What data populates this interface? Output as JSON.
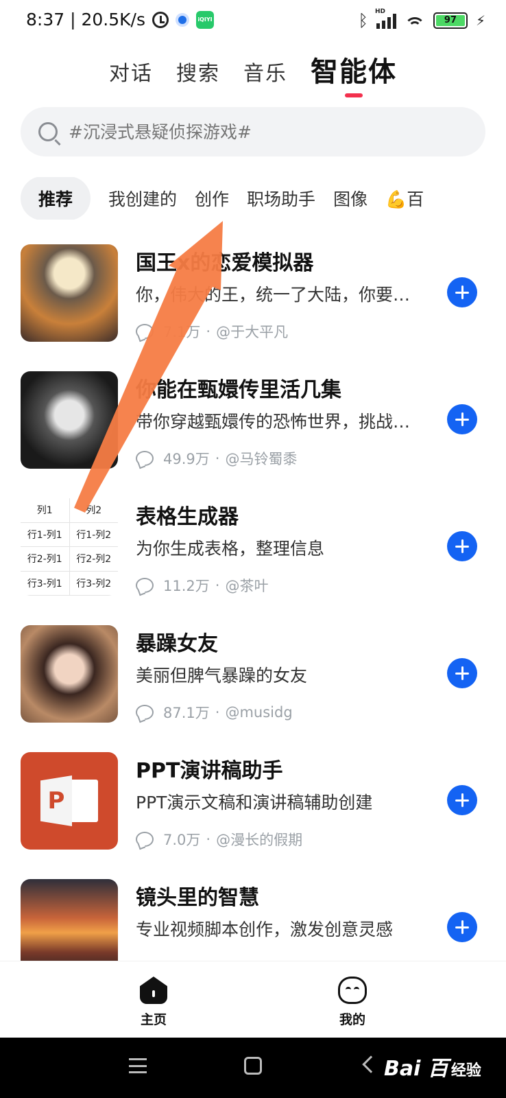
{
  "status_bar": {
    "time_speed": "8:37 | 20.5K/s",
    "battery": "97",
    "hd_label": "HD"
  },
  "top_tabs": [
    {
      "label": "对话"
    },
    {
      "label": "搜索"
    },
    {
      "label": "音乐"
    },
    {
      "label": "智能体"
    }
  ],
  "search": {
    "placeholder": "#沉浸式悬疑侦探游戏#"
  },
  "categories": [
    {
      "label": "推荐"
    },
    {
      "label": "我创建的"
    },
    {
      "label": "创作"
    },
    {
      "label": "职场助手"
    },
    {
      "label": "图像"
    },
    {
      "label": "💪百"
    }
  ],
  "agents": [
    {
      "title": "国王x的恋爱模拟器",
      "desc": "你，伟大的王，统一了大陆，你要…",
      "count": "7.1万",
      "author": "@于大平凡"
    },
    {
      "title": "你能在甄嬛传里活几集",
      "desc": "带你穿越甄嬛传的恐怖世界，挑战…",
      "count": "49.9万",
      "author": "@马铃蜀黍"
    },
    {
      "title": "表格生成器",
      "desc": "为你生成表格，整理信息",
      "count": "11.2万",
      "author": "@茶叶"
    },
    {
      "title": "暴躁女友",
      "desc": "美丽但脾气暴躁的女友",
      "count": "87.1万",
      "author": "@musidg"
    },
    {
      "title": "PPT演讲稿助手",
      "desc": "PPT演示文稿和演讲稿辅助创建",
      "count": "7.0万",
      "author": "@漫长的假期"
    },
    {
      "title": "镜头里的智慧",
      "desc": "专业视频脚本创作，激发创意灵感",
      "count": "",
      "author": ""
    }
  ],
  "table_thumb": {
    "header": [
      "列1",
      "列2"
    ],
    "rows": [
      [
        "行1-列1",
        "行1-列2"
      ],
      [
        "行2-列1",
        "行2-列2"
      ],
      [
        "行3-列1",
        "行3-列2"
      ]
    ]
  },
  "ppt_thumb_letter": "P",
  "meta_separator": "·",
  "bottom_nav": {
    "home": "主页",
    "mine": "我的"
  },
  "watermark": {
    "brand": "Bai 百",
    "suffix": "经验"
  },
  "colors": {
    "accent_blue": "#1463f3",
    "tab_underline": "#f3304d",
    "arrow_orange": "#f57c45"
  }
}
